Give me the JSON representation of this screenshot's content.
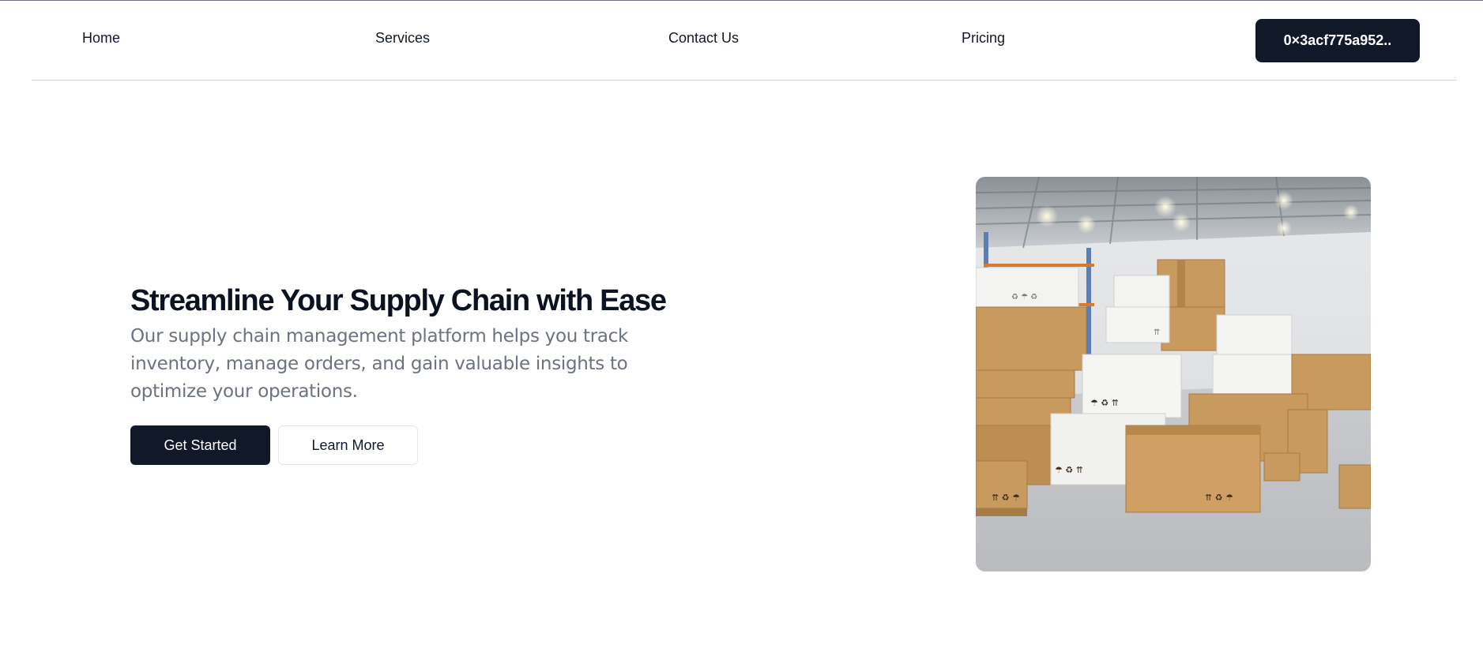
{
  "nav": {
    "links": [
      {
        "label": "Home"
      },
      {
        "label": "Services"
      },
      {
        "label": "Contact Us"
      },
      {
        "label": "Pricing"
      }
    ],
    "wallet_label": "0×3acf775a952.."
  },
  "hero": {
    "title": "Streamline Your Supply Chain with Ease",
    "subtitle": "Our supply chain management platform helps you track inventory, manage orders, and gain valuable insights to optimize your operations.",
    "primary_label": "Get Started",
    "secondary_label": "Learn More",
    "image_alt": "warehouse-boxes-photo"
  },
  "colors": {
    "primary": "#111827",
    "muted_text": "#6b7280",
    "divider": "#d1d5db"
  }
}
